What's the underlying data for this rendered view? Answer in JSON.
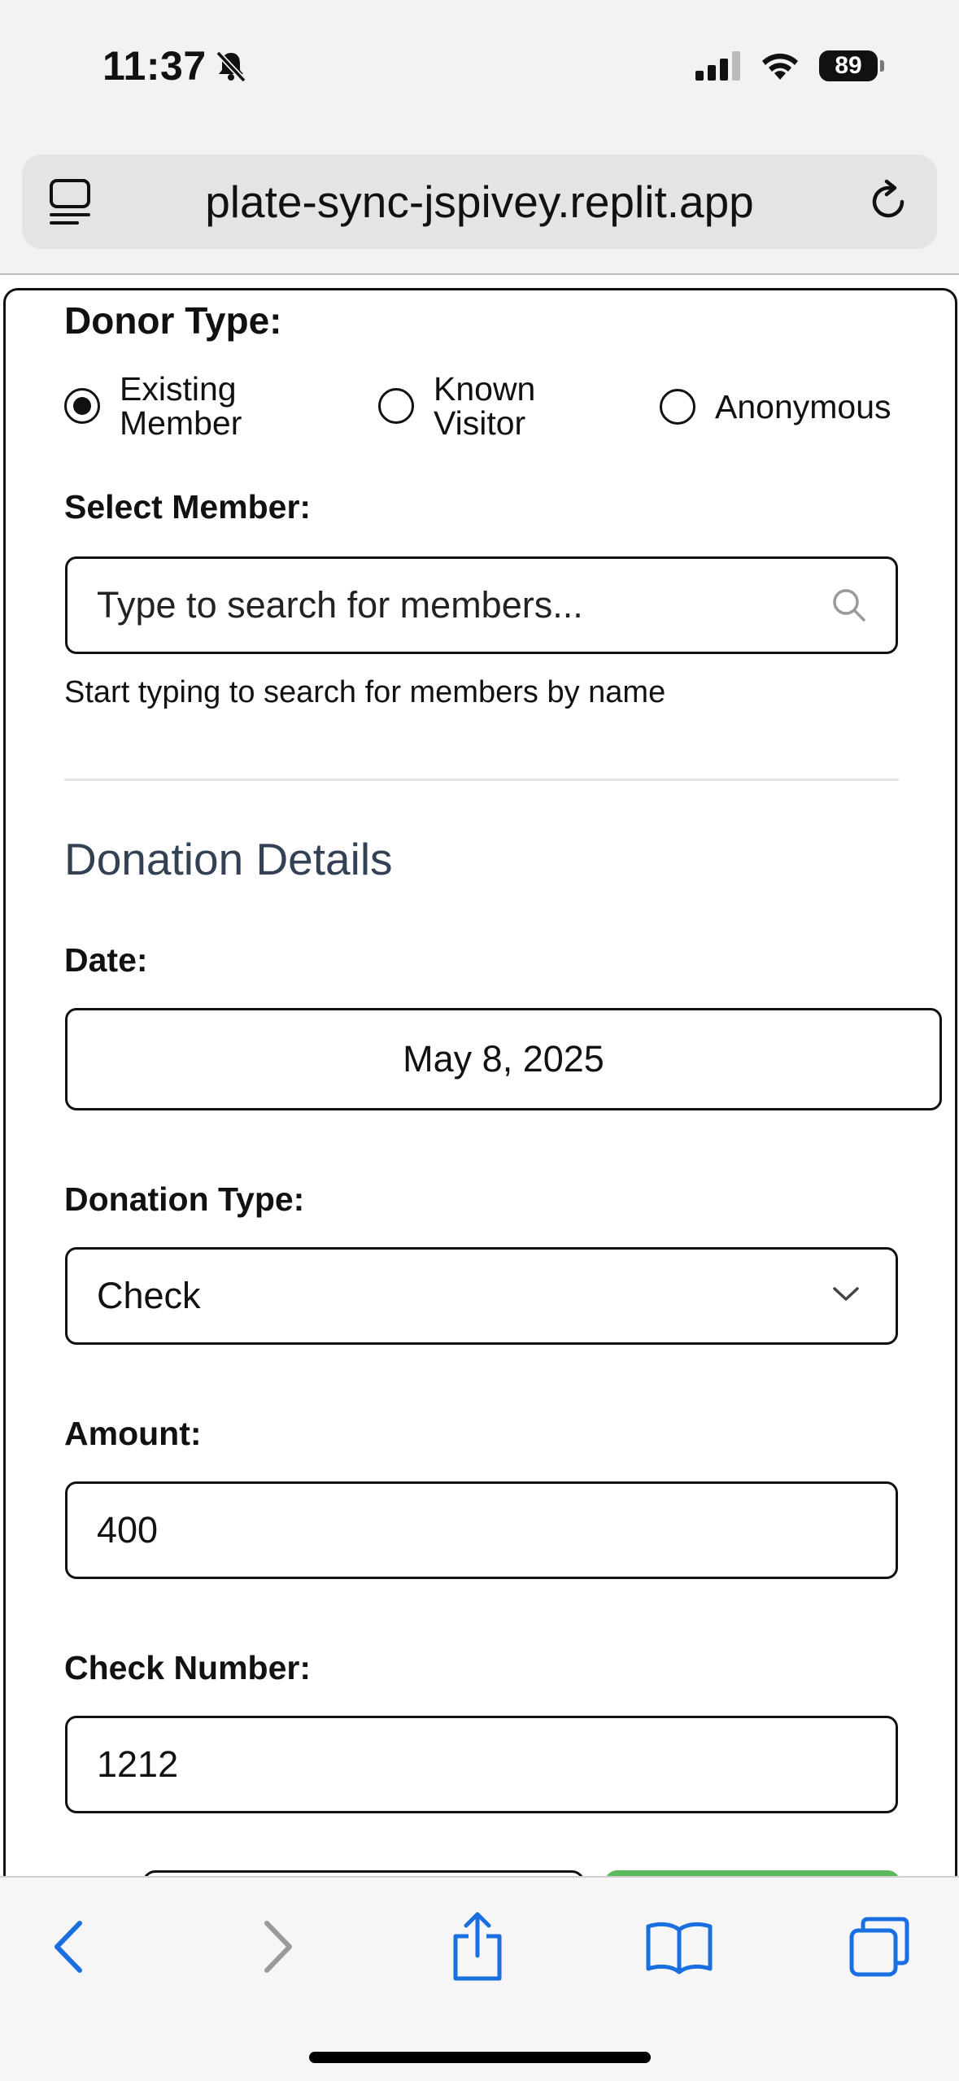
{
  "status_bar": {
    "time": "11:37",
    "battery": "89"
  },
  "browser": {
    "url": "plate-sync-jspivey.replit.app"
  },
  "form": {
    "donor_type_label": "Donor Type:",
    "donor_options": [
      {
        "line1": "Existing",
        "line2": "Member",
        "checked": true
      },
      {
        "line1": "Known",
        "line2": "Visitor",
        "checked": false
      },
      {
        "line1": "Anonymous",
        "line2": "",
        "checked": false
      }
    ],
    "select_member_label": "Select Member:",
    "member_search_placeholder": "Type to search for members...",
    "member_search_help": "Start typing to search for members by name",
    "section_title": "Donation Details",
    "date_label": "Date:",
    "date_value": "May 8, 2025",
    "donation_type_label": "Donation Type:",
    "donation_type_value": "Check",
    "amount_label": "Amount:",
    "amount_value": "400",
    "check_number_label": "Check Number:",
    "check_number_value": "1212"
  },
  "colors": {
    "accent_green": "#5cb85c",
    "link_blue": "#1a73e8",
    "section_title": "#334155"
  },
  "toolbar_icons": [
    "back-icon",
    "forward-icon",
    "share-icon",
    "bookmarks-icon",
    "tabs-icon"
  ]
}
